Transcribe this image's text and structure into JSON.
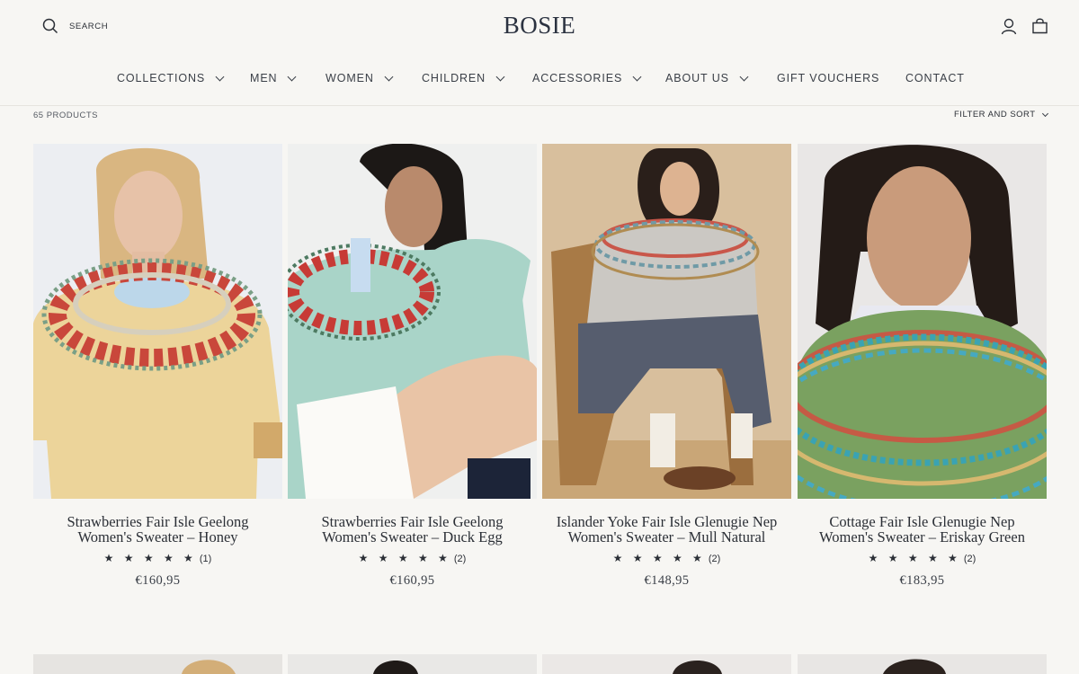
{
  "header": {
    "search_label": "SEARCH",
    "logo": "BOSIE",
    "icons": [
      "search-icon",
      "account-icon",
      "cart-icon"
    ]
  },
  "nav": [
    {
      "label": "COLLECTIONS",
      "dropdown": true
    },
    {
      "label": "MEN",
      "dropdown": true
    },
    {
      "label": "WOMEN",
      "dropdown": true
    },
    {
      "label": "CHILDREN",
      "dropdown": true
    },
    {
      "label": "ACCESSORIES",
      "dropdown": true
    },
    {
      "label": "ABOUT US",
      "dropdown": true
    },
    {
      "label": "GIFT VOUCHERS",
      "dropdown": false
    },
    {
      "label": "CONTACT",
      "dropdown": false
    }
  ],
  "toolbar": {
    "product_count": "65 PRODUCTS",
    "filter_label": "FILTER AND SORT"
  },
  "products": [
    {
      "name_line1": "Strawberries Fair Isle Geelong",
      "name_line2": "Women's Sweater – Honey",
      "stars": "★ ★ ★ ★ ★",
      "reviews": "(1)",
      "price": "€160,95"
    },
    {
      "name_line1": "Strawberries Fair Isle Geelong",
      "name_line2": "Women's Sweater – Duck Egg",
      "stars": "★ ★ ★ ★ ★",
      "reviews": "(2)",
      "price": "€160,95"
    },
    {
      "name_line1": "Islander Yoke Fair Isle Glenugie Nep",
      "name_line2": "Women's Sweater – Mull Natural",
      "stars": "★ ★ ★ ★ ★",
      "reviews": "(2)",
      "price": "€148,95"
    },
    {
      "name_line1": "Cottage Fair Isle Glenugie Nep",
      "name_line2": "Women's Sweater – Eriskay Green",
      "stars": "★ ★ ★ ★ ★",
      "reviews": "(2)",
      "price": "€183,95"
    }
  ],
  "colors": {
    "background": "#f7f6f3",
    "text": "#2b2f36",
    "logo": "#2b3240"
  }
}
